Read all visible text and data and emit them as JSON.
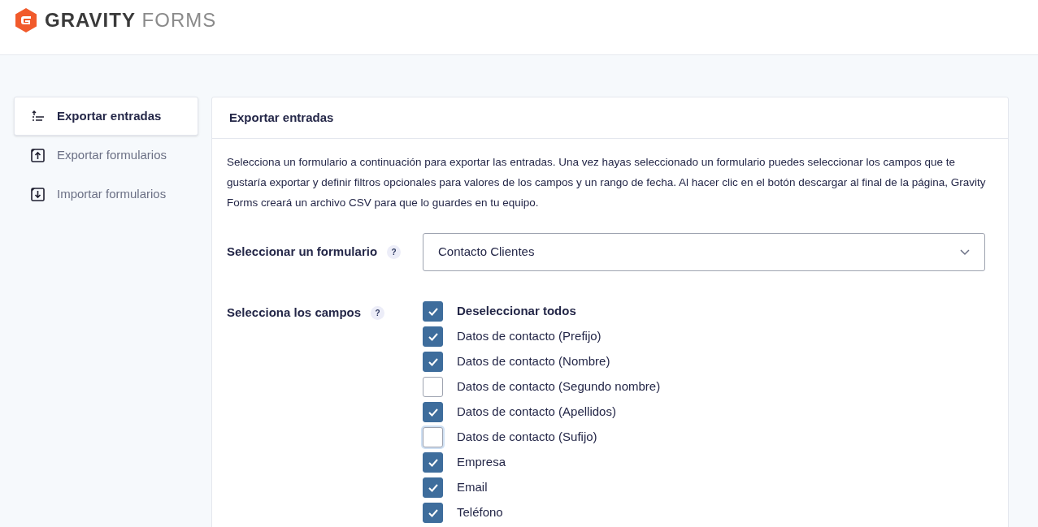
{
  "logo": {
    "brand": "GRAVITY",
    "suffix": "FORMS"
  },
  "sidebar": {
    "items": [
      {
        "label": "Exportar entradas",
        "kind": "entries",
        "selected": true
      },
      {
        "label": "Exportar formularios",
        "kind": "export",
        "selected": false
      },
      {
        "label": "Importar formularios",
        "kind": "import",
        "selected": false
      }
    ]
  },
  "panel": {
    "title": "Exportar entradas",
    "description": "Selecciona un formulario a continuación para exportar las entradas. Una vez hayas seleccionado un formulario puedes seleccionar los campos que te gustaría exportar y definir filtros opcionales para valores de los campos y un rango de fecha. Al hacer clic en el botón descargar al final de la página, Gravity Forms creará un archivo CSV para que lo guardes en tu equipo.",
    "form_select": {
      "label": "Seleccionar un formulario",
      "help": "?",
      "value": "Contacto Clientes"
    },
    "fields": {
      "label": "Selecciona los campos",
      "help": "?",
      "items": [
        {
          "label": "Deseleccionar todos",
          "kind": "toggle-all",
          "checked": true,
          "focused": false
        },
        {
          "label": "Datos de contacto (Prefijo)",
          "kind": "field",
          "checked": true,
          "focused": false
        },
        {
          "label": "Datos de contacto (Nombre)",
          "kind": "field",
          "checked": true,
          "focused": false
        },
        {
          "label": "Datos de contacto (Segundo nombre)",
          "kind": "field",
          "checked": false,
          "focused": false
        },
        {
          "label": "Datos de contacto (Apellidos)",
          "kind": "field",
          "checked": true,
          "focused": false
        },
        {
          "label": "Datos de contacto (Sufijo)",
          "kind": "field",
          "checked": false,
          "focused": true
        },
        {
          "label": "Empresa",
          "kind": "field",
          "checked": true,
          "focused": false
        },
        {
          "label": "Email",
          "kind": "field",
          "checked": true,
          "focused": false
        },
        {
          "label": "Teléfono",
          "kind": "field",
          "checked": true,
          "focused": false
        }
      ]
    }
  }
}
